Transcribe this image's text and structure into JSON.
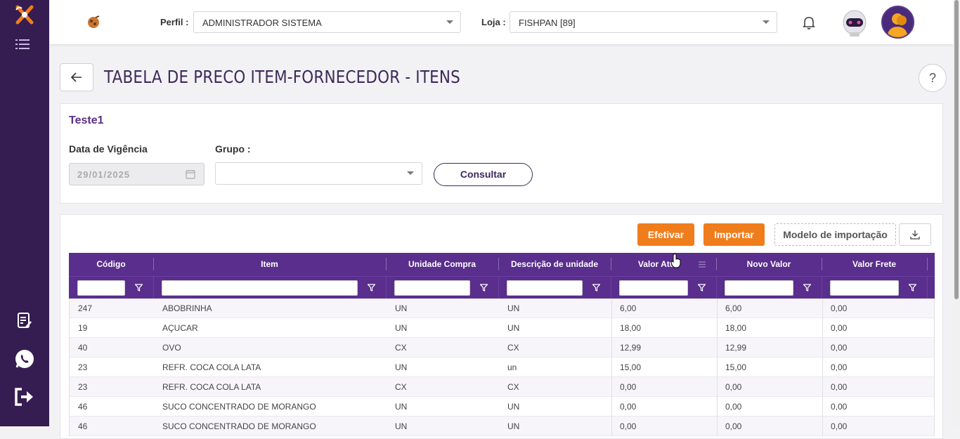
{
  "header": {
    "perfil_label": "Perfil :",
    "perfil_value": "ADMINISTRADOR SISTEMA",
    "loja_label": "Loja :",
    "loja_value": "FISHPAN [89]"
  },
  "page": {
    "title": "TABELA DE PRECO ITEM-FORNECEDOR - ITENS",
    "help": "?"
  },
  "filters": {
    "subtitle": "Teste1",
    "date_label": "Data de Vigência",
    "date_value": "29/01/2025",
    "grupo_label": "Grupo :",
    "consultar_label": "Consultar"
  },
  "actions": {
    "efetivar": "Efetivar",
    "importar": "Importar",
    "modelo": "Modelo de importação"
  },
  "grid": {
    "columns": [
      "Código",
      "Item",
      "Unidade Compra",
      "Descrição de unidade",
      "Valor Atu",
      "Novo Valor",
      "Valor Frete"
    ],
    "rows": [
      [
        "247",
        "ABOBRINHA",
        "UN",
        "UN",
        "6,00",
        "6,00",
        "0,00"
      ],
      [
        "19",
        "AÇUCAR",
        "UN",
        "UN",
        "18,00",
        "18,00",
        "0,00"
      ],
      [
        "40",
        "OVO",
        "CX",
        "CX",
        "12,99",
        "12,99",
        "0,00"
      ],
      [
        "23",
        "REFR. COCA COLA LATA",
        "UN",
        "un",
        "15,00",
        "15,00",
        "0,00"
      ],
      [
        "23",
        "REFR. COCA COLA LATA",
        "CX",
        "CX",
        "0,00",
        "0,00",
        "0,00"
      ],
      [
        "46",
        "SUCO CONCENTRADO DE MORANGO",
        "UN",
        "UN",
        "0,00",
        "0,00",
        "0,00"
      ],
      [
        "46",
        "SUCO CONCENTRADO DE MORANGO",
        "UN",
        "UN",
        "0,00",
        "0,00",
        "0,00"
      ]
    ]
  },
  "colors": {
    "sidebar": "#351d52",
    "accent_purple": "#5a2e8c",
    "orange": "#f07d1c"
  }
}
